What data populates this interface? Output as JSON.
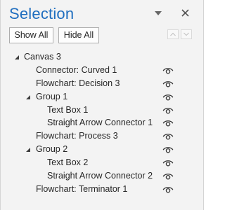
{
  "pane": {
    "title": "Selection",
    "show_all": "Show All",
    "hide_all": "Hide All",
    "accent_color": "#1f6ebf"
  },
  "icons": {
    "menu": "chevron-down-icon",
    "close": "close-icon",
    "bring_forward": "arrow-up-icon",
    "send_backward": "arrow-down-icon",
    "visibility": "eye-icon",
    "expanded": "triangle-expanded-icon"
  },
  "tree": [
    {
      "label": "Canvas 3",
      "level": 0,
      "expander": true,
      "eye": false
    },
    {
      "label": "Connector: Curved 1",
      "level": 1,
      "expander": false,
      "eye": true
    },
    {
      "label": "Flowchart: Decision 3",
      "level": 1,
      "expander": false,
      "eye": true
    },
    {
      "label": "Group 1",
      "level": 1,
      "expander": true,
      "eye": true
    },
    {
      "label": "Text Box 1",
      "level": 2,
      "expander": false,
      "eye": true
    },
    {
      "label": "Straight Arrow Connector 1",
      "level": 2,
      "expander": false,
      "eye": true
    },
    {
      "label": "Flowchart: Process 3",
      "level": 1,
      "expander": false,
      "eye": true
    },
    {
      "label": "Group 2",
      "level": 1,
      "expander": true,
      "eye": true
    },
    {
      "label": "Text Box 2",
      "level": 2,
      "expander": false,
      "eye": true
    },
    {
      "label": "Straight Arrow Connector 2",
      "level": 2,
      "expander": false,
      "eye": true
    },
    {
      "label": "Flowchart: Terminator 1",
      "level": 1,
      "expander": false,
      "eye": true
    }
  ]
}
